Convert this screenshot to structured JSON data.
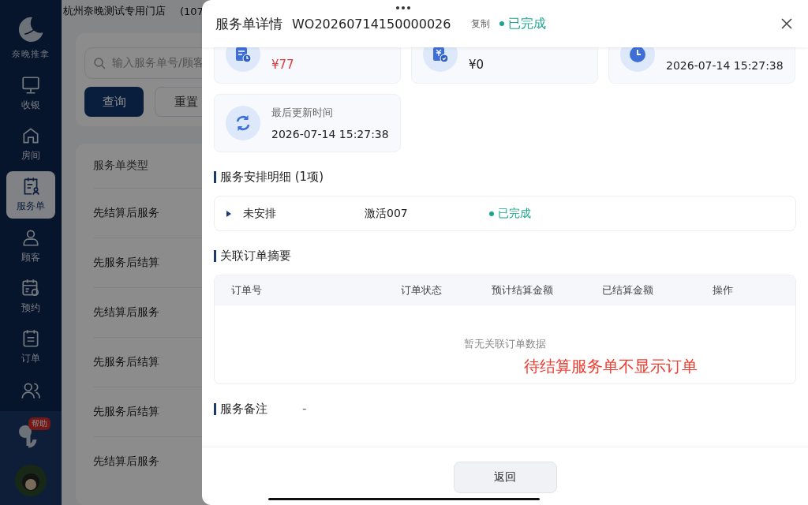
{
  "background": {
    "store": "杭州奈晚测试专用门店",
    "store_code": "(107",
    "search": {
      "placeholder": "输入服务单号/顾客"
    },
    "buttons": [
      {
        "label": "查询",
        "kind": "primary"
      },
      {
        "label": "重置",
        "kind": "plain"
      }
    ],
    "table": {
      "columns": [
        "服务单类型"
      ],
      "rows": [
        "先结算后服务",
        "先服务后结算",
        "先结算后服务",
        "先服务后结算",
        "先服务后结算",
        "先结算后服务"
      ]
    }
  },
  "sidebar": {
    "brand": "奈晚推拿",
    "items": [
      {
        "label": "收银",
        "selected": false
      },
      {
        "label": "房间",
        "selected": false
      },
      {
        "label": "服务单",
        "selected": true
      },
      {
        "label": "顾客",
        "selected": false
      },
      {
        "label": "预约",
        "selected": false
      },
      {
        "label": "订单",
        "selected": false
      },
      {
        "selected": false
      }
    ],
    "help_badge": "帮助"
  },
  "drawer": {
    "title": "服务单详情",
    "order_no": "WO20260714150000026",
    "copy": "复制",
    "status": "已完成",
    "cards": [
      {
        "kind": "due",
        "value": "¥77"
      },
      {
        "kind": "paid",
        "value": "¥0"
      },
      {
        "kind": "created",
        "value": "2026-07-14 15:27:38"
      },
      {
        "kind": "updated",
        "label": "最后更新时间",
        "value": "2026-07-14 15:27:38"
      }
    ],
    "schedule": {
      "heading": "服务安排明细 (1项)",
      "rows": [
        {
          "expanded": false,
          "name": "未安排",
          "item": "激活007",
          "status": "已完成"
        }
      ]
    },
    "orders": {
      "heading": "关联订单摘要",
      "columns": [
        "订单号",
        "订单状态",
        "预计结算金额",
        "已结算金额",
        "操作"
      ],
      "empty": "暂无关联订单数据",
      "annotation": "待结算服务单不显示订单"
    },
    "notes": {
      "heading": "服务备注",
      "value": "-"
    },
    "footer_button": "返回"
  }
}
